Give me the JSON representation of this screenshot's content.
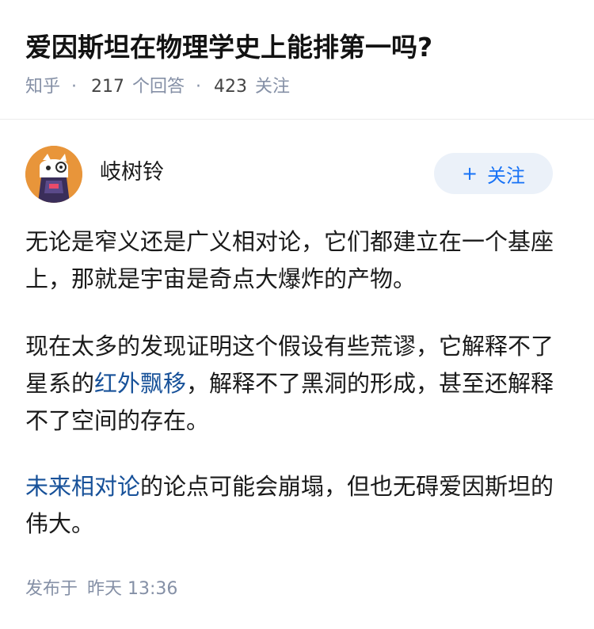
{
  "question": {
    "title": "爱因斯坦在物理学史上能排第一吗?",
    "source": "知乎",
    "separator": "·",
    "answer_count": "217",
    "answer_label": "个回答",
    "follower_count": "423",
    "follower_label": "关注"
  },
  "answer": {
    "author": "岐树铃",
    "follow_button": {
      "icon": "+",
      "label": "关注"
    },
    "paragraphs": [
      {
        "text": "无论是窄义还是广义相对论，它们都建立在一个基座上，那就是宇宙是奇点大爆炸的产物。"
      },
      {
        "before": "现在太多的发现证明这个假设有些荒谬，它解释不了星系的",
        "link": "红外飘移",
        "after": "，解释不了黑洞的形成，甚至还解释不了空间的存在。"
      },
      {
        "link": "未来相对论",
        "after": "的论点可能会崩塌，但也无碍爱因斯坦的伟大。"
      }
    ],
    "published_label": "发布于",
    "published_time": "昨天 13:36"
  },
  "colors": {
    "link": "#175199",
    "follow_button_bg": "#ebf1f9",
    "follow_button_text": "#1772f6",
    "meta_text": "#8590a6",
    "avatar_bg": "#e8953a"
  }
}
